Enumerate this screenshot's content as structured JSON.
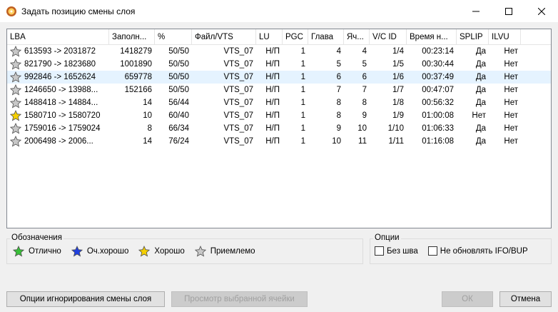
{
  "window": {
    "title": "Задать позицию смены слоя",
    "icon": "app-icon"
  },
  "table": {
    "columns": [
      "LBA",
      "Заполн...",
      "%",
      "Файл/VTS",
      "LU",
      "PGC",
      "Глава",
      "Яч...",
      "V/C ID",
      "Время н...",
      "SPLIP",
      "ILVU"
    ],
    "rows": [
      {
        "star": "silver",
        "lba": "613593 -> 2031872",
        "fill": "1418279",
        "pct": "50/50",
        "vts": "VTS_07",
        "lu": "Н/П",
        "pgc": "1",
        "chapter": "4",
        "cell": "4",
        "vcid": "1/4",
        "time": "00:23:14",
        "splip": "Да",
        "ilvu": "Нет"
      },
      {
        "star": "silver",
        "lba": "821790 -> 1823680",
        "fill": "1001890",
        "pct": "50/50",
        "vts": "VTS_07",
        "lu": "Н/П",
        "pgc": "1",
        "chapter": "5",
        "cell": "5",
        "vcid": "1/5",
        "time": "00:30:44",
        "splip": "Да",
        "ilvu": "Нет"
      },
      {
        "star": "silver",
        "lba": "992846 -> 1652624",
        "fill": "659778",
        "pct": "50/50",
        "vts": "VTS_07",
        "lu": "Н/П",
        "pgc": "1",
        "chapter": "6",
        "cell": "6",
        "vcid": "1/6",
        "time": "00:37:49",
        "splip": "Да",
        "ilvu": "Нет",
        "selected": true
      },
      {
        "star": "silver",
        "lba": "1246650 -> 13988...",
        "fill": "152166",
        "pct": "50/50",
        "vts": "VTS_07",
        "lu": "Н/П",
        "pgc": "1",
        "chapter": "7",
        "cell": "7",
        "vcid": "1/7",
        "time": "00:47:07",
        "splip": "Да",
        "ilvu": "Нет"
      },
      {
        "star": "silver",
        "lba": "1488418 -> 14884...",
        "fill": "14",
        "pct": "56/44",
        "vts": "VTS_07",
        "lu": "Н/П",
        "pgc": "1",
        "chapter": "8",
        "cell": "8",
        "vcid": "1/8",
        "time": "00:56:32",
        "splip": "Да",
        "ilvu": "Нет"
      },
      {
        "star": "gold",
        "lba": "1580710 -> 1580720",
        "fill": "10",
        "pct": "60/40",
        "vts": "VTS_07",
        "lu": "Н/П",
        "pgc": "1",
        "chapter": "8",
        "cell": "9",
        "vcid": "1/9",
        "time": "01:00:08",
        "splip": "Нет",
        "ilvu": "Нет"
      },
      {
        "star": "silver",
        "lba": "1759016 -> 1759024",
        "fill": "8",
        "pct": "66/34",
        "vts": "VTS_07",
        "lu": "Н/П",
        "pgc": "1",
        "chapter": "9",
        "cell": "10",
        "vcid": "1/10",
        "time": "01:06:33",
        "splip": "Да",
        "ilvu": "Нет"
      },
      {
        "star": "silver",
        "lba": "2006498 -> 2006...",
        "fill": "14",
        "pct": "76/24",
        "vts": "VTS_07",
        "lu": "Н/П",
        "pgc": "1",
        "chapter": "10",
        "cell": "11",
        "vcid": "1/11",
        "time": "01:16:08",
        "splip": "Да",
        "ilvu": "Нет"
      }
    ]
  },
  "legend": {
    "title": "Обозначения",
    "items": [
      {
        "star": "green",
        "label": "Отлично"
      },
      {
        "star": "blue",
        "label": "Оч.хорошо"
      },
      {
        "star": "gold",
        "label": "Хорошо"
      },
      {
        "star": "silver",
        "label": "Приемлемо"
      }
    ]
  },
  "options": {
    "title": "Опции",
    "no_seam": "Без шва",
    "no_update": "Не обновлять IFO/BUP"
  },
  "buttons": {
    "ignore": "Опции игнорирования смены слоя",
    "view": "Просмотр выбранной ячейки",
    "ok": "ОК",
    "cancel": "Отмена"
  },
  "colors": {
    "selected_row": "#e5f3ff",
    "star_silver": "#c8c8c8",
    "star_gold": "#f5d000",
    "star_green": "#38c038",
    "star_blue": "#2040e0"
  }
}
